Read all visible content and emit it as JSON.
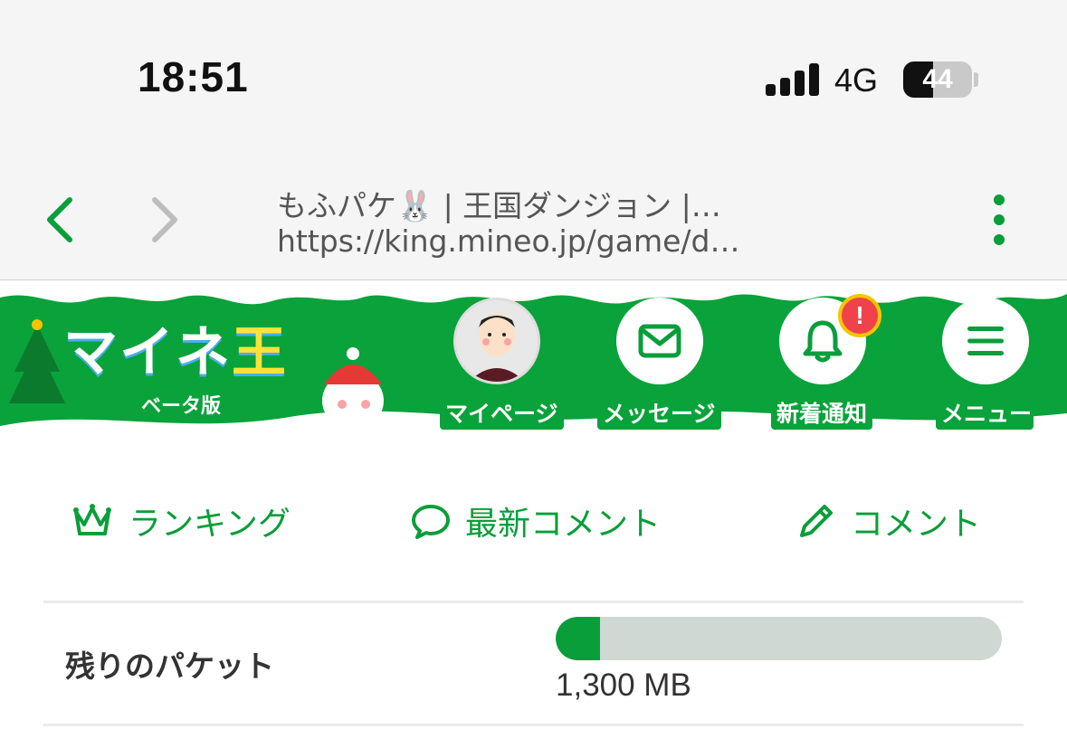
{
  "status_bar": {
    "time": "18:51",
    "network": "4G",
    "battery": "44",
    "battery_level": 0.44
  },
  "browser": {
    "page_title": "もふパケ🐰 | 王国ダンジョン |…",
    "url": "https://king.mineo.jp/game/d…",
    "back_icon": "chevron-left-icon",
    "forward_icon": "chevron-right-icon",
    "menu_icon": "more-vertical-icon"
  },
  "header": {
    "logo_text_main": "マイネ",
    "logo_text_accent": "王",
    "logo_sub": "ベータ版",
    "buttons": [
      {
        "label": "マイページ",
        "icon": "avatar"
      },
      {
        "label": "メッセージ",
        "icon": "envelope-icon"
      },
      {
        "label": "新着通知",
        "icon": "bell-icon",
        "badge": "!"
      },
      {
        "label": "メニュー",
        "icon": "hamburger-icon"
      }
    ]
  },
  "subnav": [
    {
      "label": "ランキング",
      "icon": "crown-icon"
    },
    {
      "label": "最新コメント",
      "icon": "speech-bubble-icon"
    },
    {
      "label": "コメント",
      "icon": "pencil-icon"
    }
  ],
  "packet": {
    "label": "残りのパケット",
    "value": "1,300 MB",
    "fill_fraction": 0.1
  },
  "colors": {
    "brand_green": "#0a9e3a",
    "banner_green": "#0aa23a",
    "badge_red": "#f0424a",
    "badge_ring": "#f6c500",
    "bar_track": "#cfd8d3"
  }
}
